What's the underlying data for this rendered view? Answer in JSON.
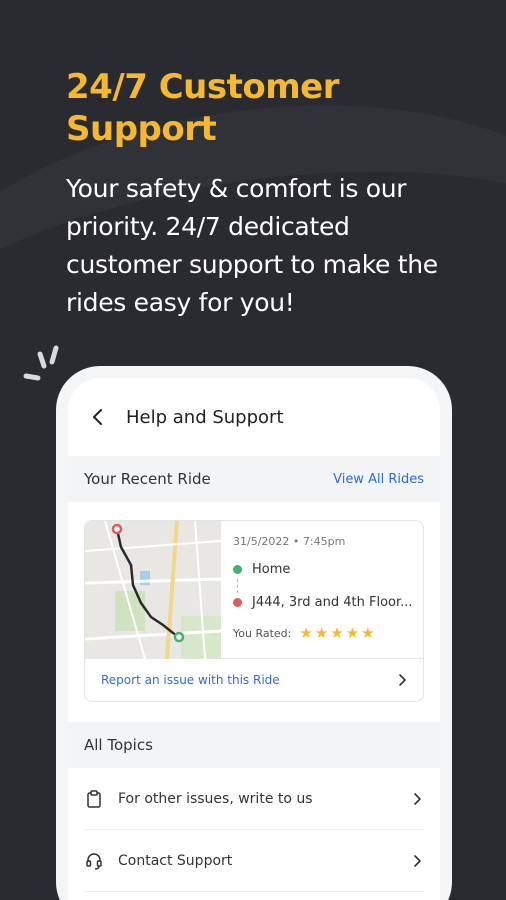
{
  "promo": {
    "headline": "24/7 Customer Support",
    "subhead": "Your safety & comfort is our priority. 24/7 dedicated customer support to make the rides easy for you!"
  },
  "colors": {
    "accent": "#f5b82e",
    "link": "#2f6bdb",
    "background": "#2a2b30"
  },
  "header": {
    "title": "Help and Support"
  },
  "recent_ride": {
    "section_title": "Your Recent Ride",
    "view_all_label": "View All Rides",
    "date": "31/5/2022",
    "time": "7:45pm",
    "pickup": "Home",
    "dropoff": "J444, 3rd and 4th Floor...",
    "rated_label": "You Rated:",
    "stars": "★★★★★",
    "rating": 5,
    "report_label": "Report an issue with this Ride"
  },
  "topics": {
    "section_title": "All Topics",
    "items": [
      {
        "label": "For other issues, write to us",
        "icon": "clipboard-icon"
      },
      {
        "label": "Contact Support",
        "icon": "headset-icon"
      }
    ]
  }
}
